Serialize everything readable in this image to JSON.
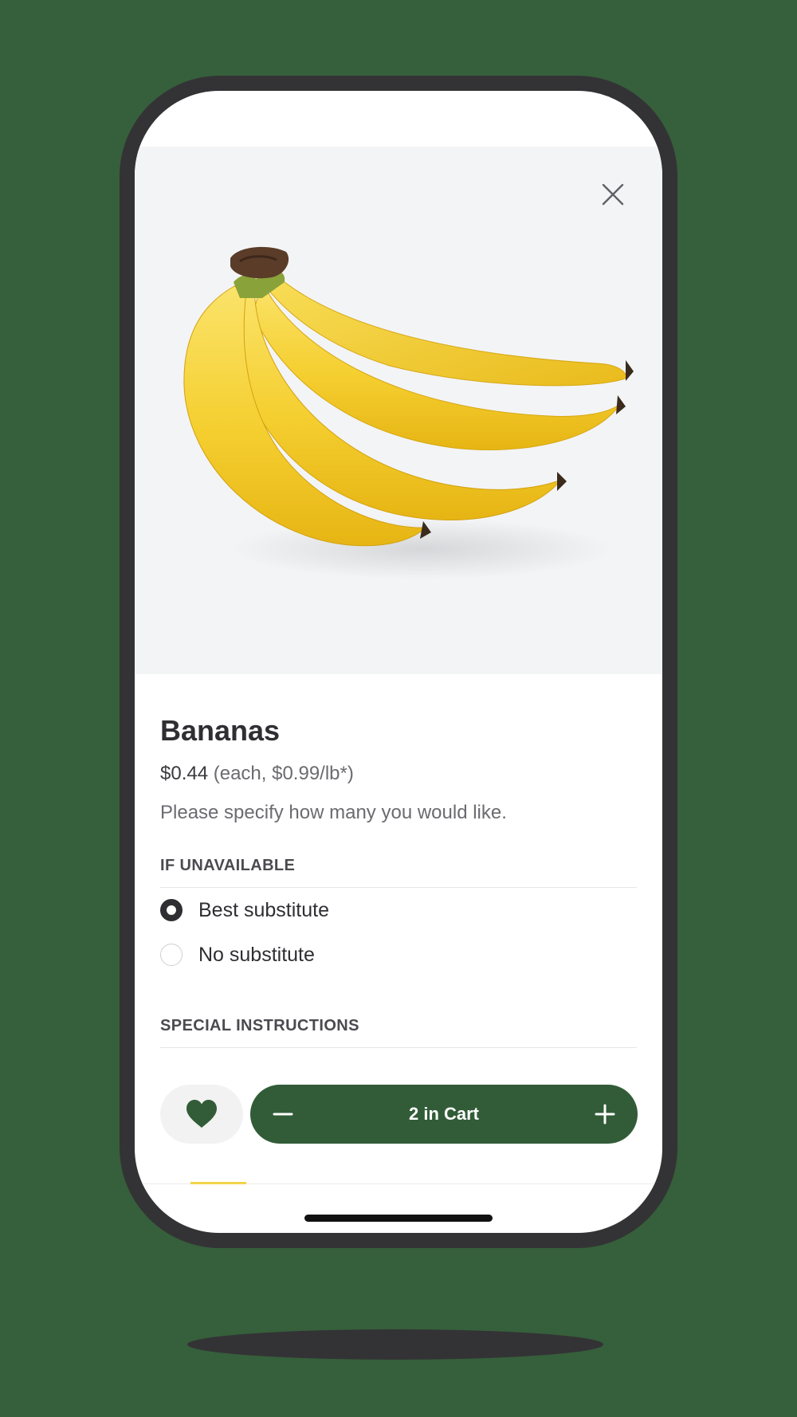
{
  "product": {
    "name": "Bananas",
    "price": "$0.44",
    "unit_price": "(each, $0.99/lb*)",
    "description": "Please specify how many you would like."
  },
  "unavailable": {
    "heading": "IF UNAVAILABLE",
    "options": [
      {
        "label": "Best substitute",
        "selected": true
      },
      {
        "label": "No substitute",
        "selected": false
      }
    ]
  },
  "special_instructions": {
    "heading": "SPECIAL INSTRUCTIONS"
  },
  "cart": {
    "label": "2 in Cart"
  },
  "icons": {
    "close": "close-icon",
    "favorite": "heart-icon",
    "decrement": "minus-icon",
    "increment": "plus-icon"
  },
  "colors": {
    "background": "#365f3b",
    "accent": "#315c37",
    "phone_frame": "#333335",
    "image_background": "#f3f4f6"
  }
}
